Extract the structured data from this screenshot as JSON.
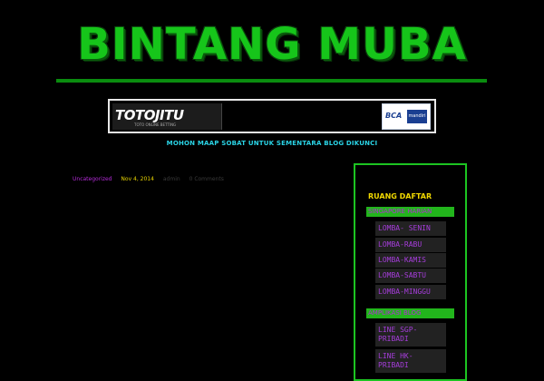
{
  "header": {
    "site_title": "BINTANG MUBA"
  },
  "banner": {
    "logo_text": "TOTOJITU",
    "logo_subtext": "TOTO ONLINE BETTING",
    "bank_bca": "BCA",
    "bank_mandiri": "mandiri"
  },
  "notice": "MOHON MAAP SOBAT UNTUK SEMENTARA BLOG DIKUNCI",
  "post_meta": {
    "category": "Uncategorized",
    "date": "Nov 4, 2014",
    "author": "admin",
    "comments": "0 Comments"
  },
  "sidebar": {
    "title": "RUANG DAFTAR",
    "sections": [
      {
        "heading": "SINGAPORE HARIAN",
        "links": [
          "LOMBA- SENIN",
          "LOMBA-RABU",
          "LOMBA-KAMIS",
          "LOMBA-SABTU",
          "LOMBA-MINGGU"
        ]
      },
      {
        "heading": "AMPLIKASI BLOG",
        "links": [
          "LINE SGP-PRIBADI",
          "LINE HK-PRIBADI"
        ]
      }
    ]
  },
  "colors": {
    "background": "#000000",
    "logo_green": "#16c51a",
    "notice_cyan": "#2ad4e6",
    "link_purple": "#a63ddb",
    "title_yellow": "#f0d800",
    "sidebar_border": "#1cc421"
  }
}
